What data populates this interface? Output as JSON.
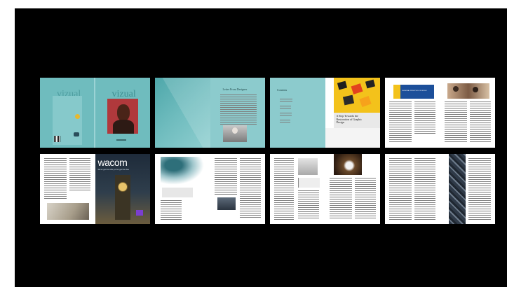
{
  "viewer": {
    "background": "#000000",
    "spread_count": 8
  },
  "colors": {
    "teal": "#6fbcbe",
    "teal_dark": "#55a9ac",
    "teal_light": "#9fd2d3",
    "yellow": "#f3c21b",
    "blue": "#1c4f9a",
    "dark": "#1e2b3a"
  },
  "spreads": [
    {
      "id": 1,
      "left_title": "vizual",
      "right_title": "vizual"
    },
    {
      "id": 2,
      "heading": "Letter From Designer"
    },
    {
      "id": 3,
      "toc_title": "Contents",
      "article_title": "A Step Towards the Restoration of Graphic Design"
    },
    {
      "id": 4,
      "feature_title": "UNIVERSAL PRINCIPLES OF DESIGN"
    },
    {
      "id": 5,
      "ad_brand": "wacom",
      "ad_tagline": "We've got the write you've got the idea"
    },
    {
      "id": 6
    },
    {
      "id": 7
    },
    {
      "id": 8
    }
  ]
}
